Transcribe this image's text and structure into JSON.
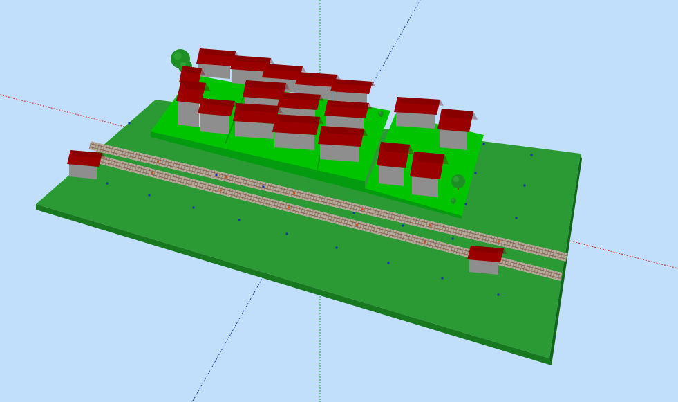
{
  "viewport": {
    "name": "3d-model-viewport",
    "background": "#c1dffb"
  },
  "colors": {
    "baseboard_top": "#2b9a35",
    "baseboard_edge": "#187820",
    "platform_top": "#00c400",
    "platform_edge": "#049b10",
    "roof": "#9a0000",
    "roof_dark": "#6b0000",
    "wall_light": "#d2d2d2",
    "wall_dark": "#8e8e8e",
    "tree": "#1e8f24",
    "axis_red": "#d42020",
    "axis_green": "#10b010",
    "axis_blue": "#1a3da8",
    "marker": "#1733a6",
    "ballast": "#b8aa9c",
    "rail": "#8c6b55"
  },
  "scene": {
    "tracks": 2,
    "houses": 20,
    "trees": 4,
    "axes": [
      "red-axis",
      "green-axis",
      "blue-axis"
    ]
  }
}
